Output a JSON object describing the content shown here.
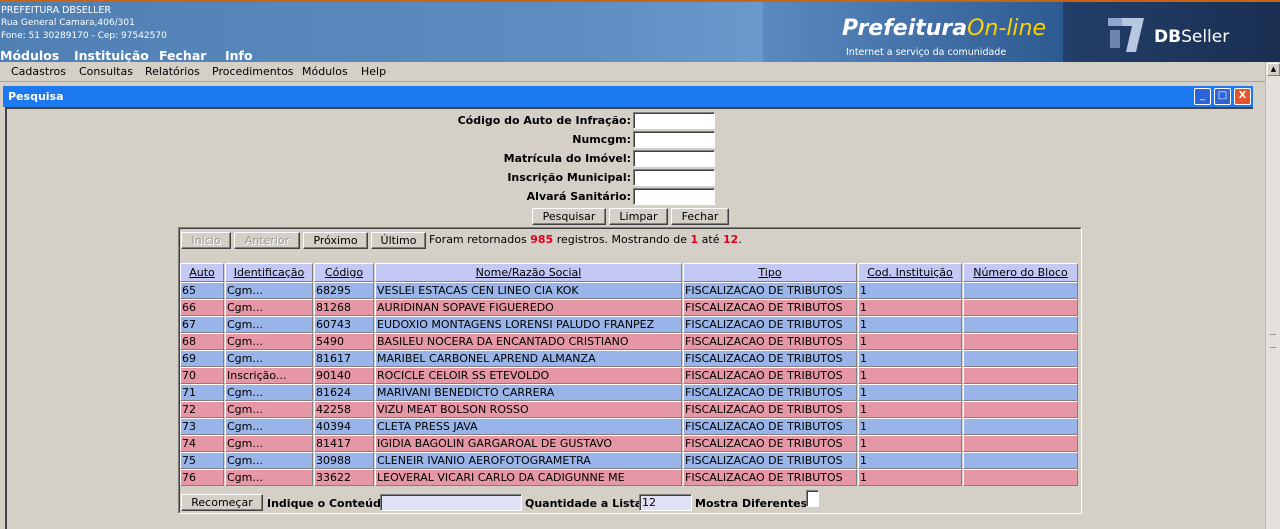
{
  "header": {
    "org_name": "PREFEITURA DBSELLER",
    "address": "Rua General Camara,406/301",
    "phone": "Fone: 51 30289170  -  Cep: 97542570",
    "main_menu": [
      "Módulos",
      "Instituição",
      "Fechar",
      "Info"
    ],
    "brand_prefix": "Prefeitura",
    "brand_suffix": "On-line",
    "brand_tagline": "Internet a serviço da comunidade",
    "dbseller_bold": "DB",
    "dbseller_rest": "Seller"
  },
  "menubar": {
    "items": [
      "Cadastros",
      "Consultas",
      "Relatórios",
      "Procedimentos",
      "Módulos",
      "Help"
    ]
  },
  "window": {
    "title": "Pesquisa",
    "minimize_glyph": "_",
    "maximize_glyph": "□",
    "close_glyph": "X"
  },
  "form": {
    "fields": [
      {
        "label": "Código do Auto de Infração:",
        "value": ""
      },
      {
        "label": "Numcgm:",
        "value": ""
      },
      {
        "label": "Matrícula do Imóvel:",
        "value": ""
      },
      {
        "label": "Inscrição Municipal:",
        "value": ""
      },
      {
        "label": "Alvará Sanitário:",
        "value": ""
      }
    ],
    "buttons": {
      "search": "Pesquisar",
      "clear": "Limpar",
      "close": "Fechar"
    }
  },
  "pagination": {
    "first": "Início",
    "previous": "Anterior",
    "next": "Próximo",
    "last": "Último",
    "msg_prefix": "Foram retornados",
    "total": "985",
    "msg_mid": "registros. Mostrando de",
    "from": "1",
    "msg_until": "até",
    "to": "12",
    "msg_end": "."
  },
  "table": {
    "columns": [
      "Auto",
      "Identificação",
      "Código",
      "Nome/Razão Social",
      "Tipo",
      "Cod. Instituição",
      "Número do Bloco"
    ],
    "rows": [
      [
        "65",
        "Cgm...",
        "68295",
        "VESLEI ESTACAS CEN LINEO CIA KOK",
        "FISCALIZACAO DE TRIBUTOS",
        "1",
        ""
      ],
      [
        "66",
        "Cgm...",
        "81268",
        "AURIDINAN SOPAVE FIGUEREDO",
        "FISCALIZACAO DE TRIBUTOS",
        "1",
        ""
      ],
      [
        "67",
        "Cgm...",
        "60743",
        "EUDOXIO MONTAGENS LORENSI PALUDO FRANPEZ",
        "FISCALIZACAO DE TRIBUTOS",
        "1",
        ""
      ],
      [
        "68",
        "Cgm...",
        "5490",
        "BASILEU NOCERA DA ENCANTADO CRISTIANO",
        "FISCALIZACAO DE TRIBUTOS",
        "1",
        ""
      ],
      [
        "69",
        "Cgm...",
        "81617",
        "MARIBEL CARBONEL APREND ALMANZA",
        "FISCALIZACAO DE TRIBUTOS",
        "1",
        ""
      ],
      [
        "70",
        "Inscrição...",
        "90140",
        "ROCICLE CELOIR SS ETEVOLDO",
        "FISCALIZACAO DE TRIBUTOS",
        "1",
        ""
      ],
      [
        "71",
        "Cgm...",
        "81624",
        "MARIVANI BENEDICTO CARRERA",
        "FISCALIZACAO DE TRIBUTOS",
        "1",
        ""
      ],
      [
        "72",
        "Cgm...",
        "42258",
        "VIZU MEAT BOLSON ROSSO",
        "FISCALIZACAO DE TRIBUTOS",
        "1",
        ""
      ],
      [
        "73",
        "Cgm...",
        "40394",
        "CLETA PRESS JAVA",
        "FISCALIZACAO DE TRIBUTOS",
        "1",
        ""
      ],
      [
        "74",
        "Cgm...",
        "81417",
        "IGIDIA BAGOLIN GARGAROAL DE GUSTAVO",
        "FISCALIZACAO DE TRIBUTOS",
        "1",
        ""
      ],
      [
        "75",
        "Cgm...",
        "30988",
        "CLENEIR IVANIO AEROFOTOGRAMETRA",
        "FISCALIZACAO DE TRIBUTOS",
        "1",
        ""
      ],
      [
        "76",
        "Cgm...",
        "33622",
        "LEOVERAL VICARI CARLO DA CADIGUNNE ME",
        "FISCALIZACAO DE TRIBUTOS",
        "1",
        ""
      ]
    ],
    "row_colors": {
      "odd": "#98b4e8",
      "even": "#e597a5"
    }
  },
  "footer": {
    "restart": "Recomeçar",
    "content_label": "Indique o Conteúdo:",
    "content_value": "",
    "qty_label": "Quantidade a Listar:",
    "qty_value": "12",
    "distinct_label": "Mostra Diferentes:"
  }
}
